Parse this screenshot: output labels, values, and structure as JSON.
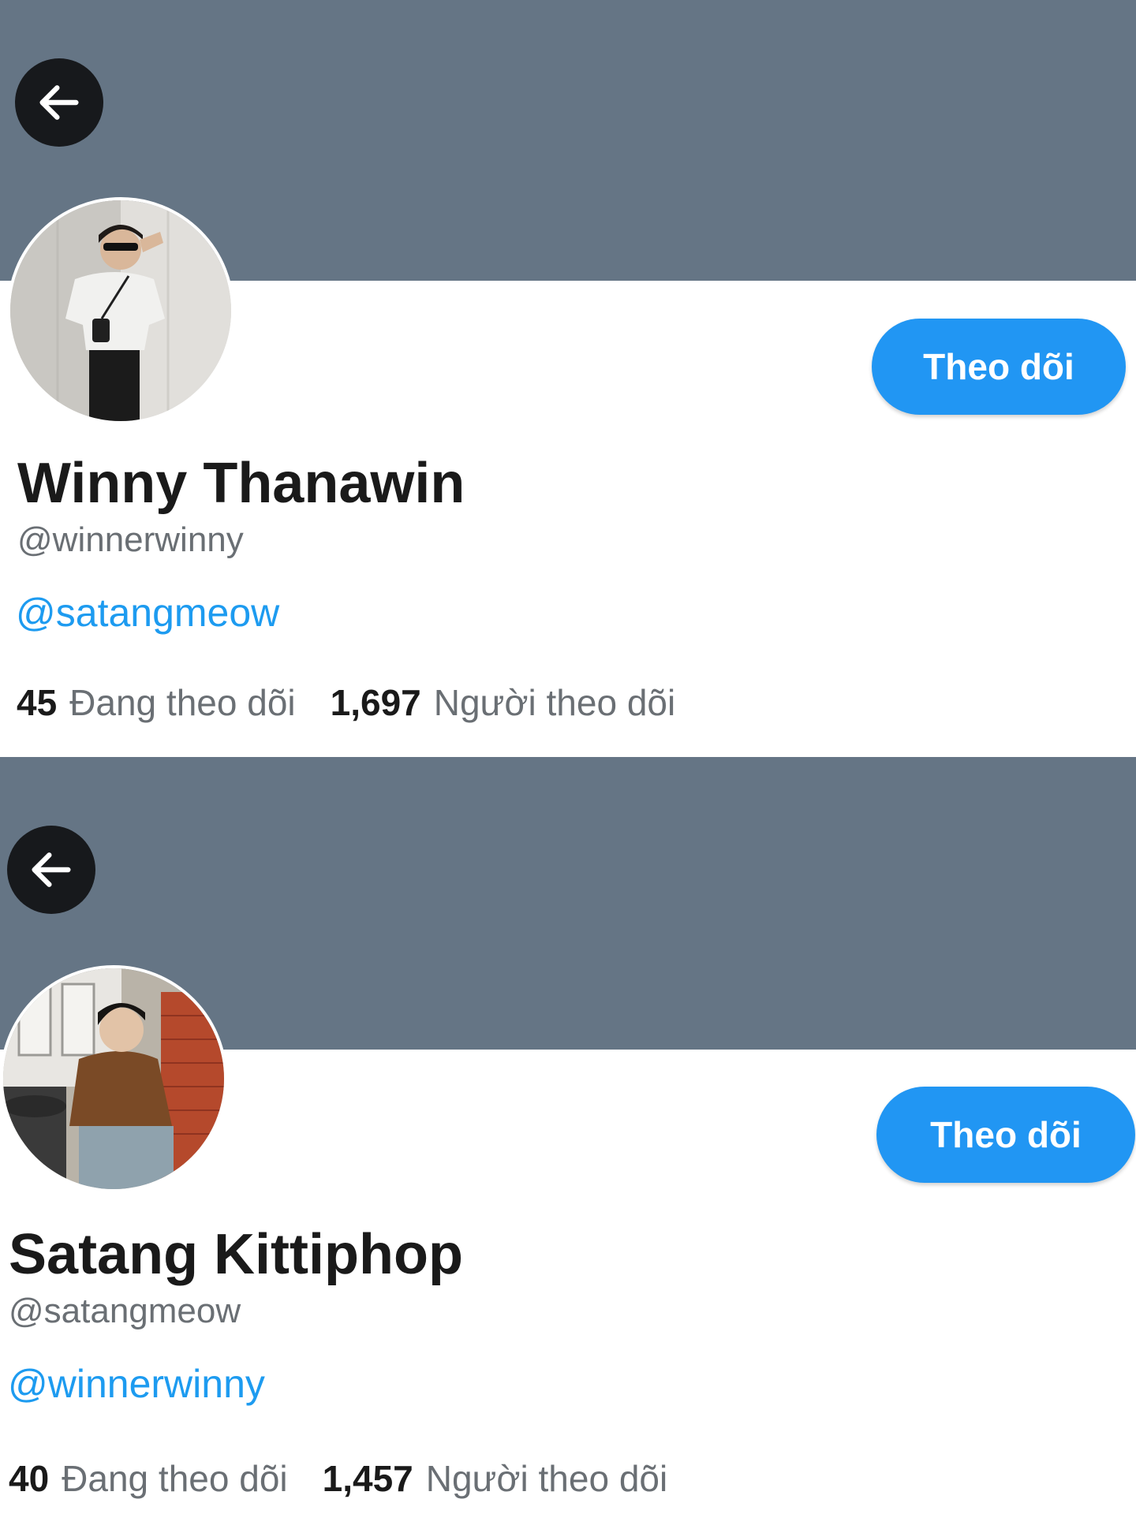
{
  "colors": {
    "banner": "#657585",
    "accent": "#1d9bf0",
    "follow_button": "#2196f3",
    "back_button": "#17191c",
    "name": "#1a1a1a",
    "secondary_text": "#6a6f74"
  },
  "icons": {
    "back": "arrow-left-icon"
  },
  "profiles": [
    {
      "display_name": "Winny Thanawin",
      "handle": "@winnerwinny",
      "bio_mention": "@satangmeow",
      "follow_label": "Theo dõi",
      "following_count": "45",
      "following_label": "Đang theo dõi",
      "followers_count": "1,697",
      "followers_label": "Người theo dõi"
    },
    {
      "display_name": "Satang Kittiphop",
      "handle": "@satangmeow",
      "bio_mention": "@winnerwinny",
      "follow_label": "Theo dõi",
      "following_count": "40",
      "following_label": "Đang theo dõi",
      "followers_count": "1,457",
      "followers_label": "Người theo dõi"
    }
  ]
}
